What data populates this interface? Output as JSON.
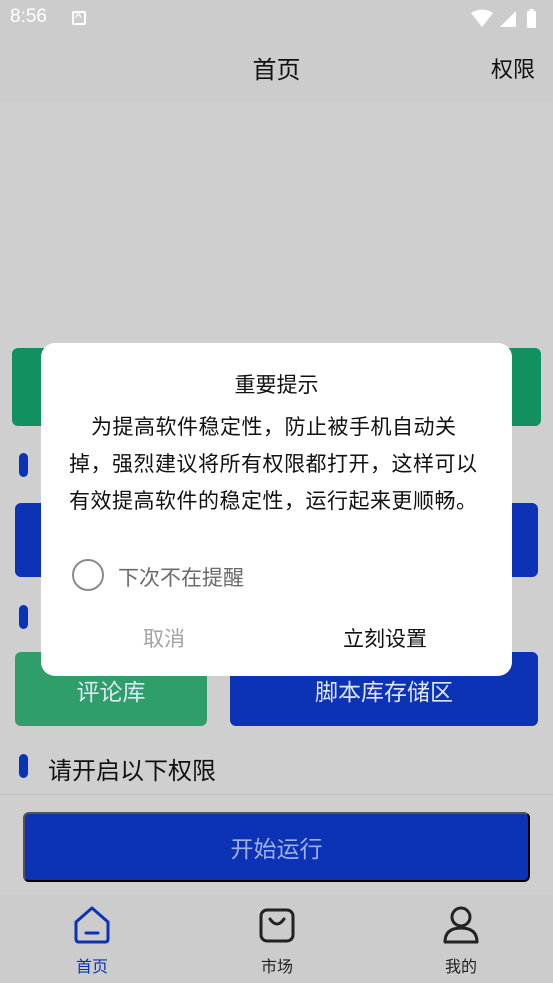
{
  "status_bar": {
    "time": "8:56"
  },
  "header": {
    "title": "首页",
    "right_action": "权限"
  },
  "content": {
    "card_comment_library": "评论库",
    "card_script_storage": "脚本库存储区",
    "permissions_section_title": "请开启以下权限",
    "start_button": "开始运行"
  },
  "dialog": {
    "title": "重要提示",
    "message": "为提高软件稳定性，防止被手机自动关掉，强烈建议将所有权限都打开，这样可以有效提高软件的稳定性，运行起来更顺畅。",
    "checkbox_label": "下次不在提醒",
    "checkbox_checked": false,
    "cancel_label": "取消",
    "confirm_label": "立刻设置"
  },
  "bottom_nav": {
    "items": [
      {
        "label": "首页",
        "icon": "home-icon",
        "active": true
      },
      {
        "label": "市场",
        "icon": "shopping-bag-icon",
        "active": false
      },
      {
        "label": "我的",
        "icon": "user-icon",
        "active": false
      }
    ]
  },
  "colors": {
    "primary": "#0c33b5",
    "green": "#129060",
    "light_green": "#2f9e6b",
    "background": "#cccccc"
  }
}
